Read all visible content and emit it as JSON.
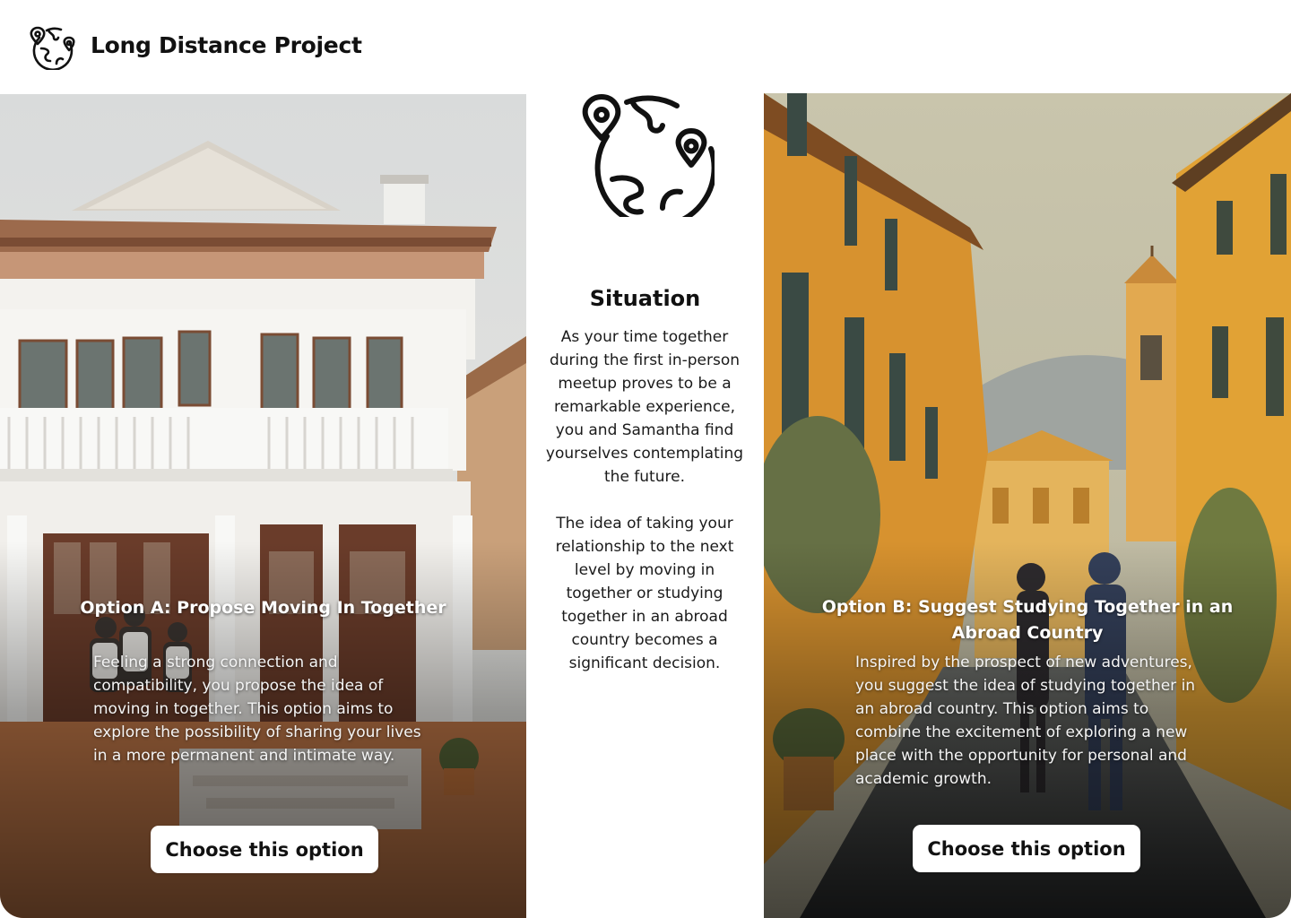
{
  "header": {
    "app_title": "Long Distance Project",
    "logo_icon": "globe-with-pins-icon"
  },
  "option_a": {
    "title": "Option A: Propose Moving In Together",
    "description": "Feeling a strong connection and compatibility, you propose the idea of moving in together. This option aims to explore the possibility of sharing your lives in a more permanent and intimate way.",
    "button_label": "Choose this option",
    "image": "white-two-story-house-illustration"
  },
  "situation": {
    "icon": "globe-with-pins-icon",
    "title": "Situation",
    "paragraph_1": "As your time together during the first in-person meetup proves to be a remarkable experience, you and Samantha find yourselves contemplating the future.",
    "paragraph_2": "The idea of taking your relationship to the next level by moving in together or studying together in an abroad country becomes a significant decision."
  },
  "option_b": {
    "title": "Option B: Suggest Studying Together in an Abroad Country",
    "description": "Inspired by the prospect of new adventures, you suggest the idea of studying together in an abroad country. This option aims to combine the excitement of exploring a new place with the opportunity for personal and academic growth.",
    "button_label": "Choose this option",
    "image": "couple-walking-european-street-painting"
  },
  "colors": {
    "text": "#111111",
    "button_bg": "#ffffff",
    "facade_orange": "#d9952f",
    "house_trim": "#8a5a3a"
  }
}
